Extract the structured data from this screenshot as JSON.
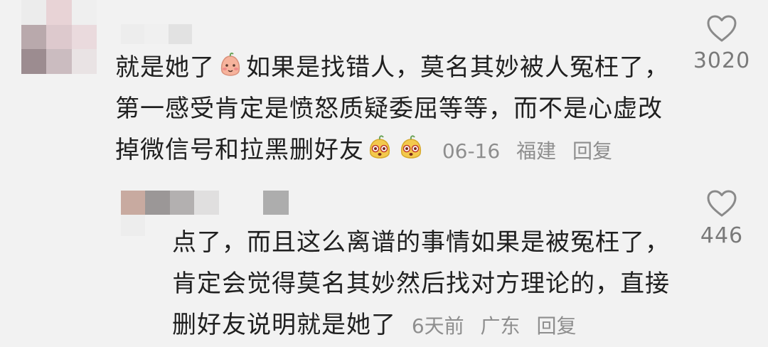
{
  "comments": [
    {
      "text_lines": [
        "就是她了",
        "如果是找错人，莫名其妙被人冤枉了，",
        "第一感受肯定是愤怒质疑委屈等等，而不是心虚改",
        "掉微信号和拉黑删好友"
      ],
      "emoji_names": [
        "blush-face-emoji",
        "shocked-face-emoji",
        "shocked-face-emoji"
      ],
      "date": "06-16",
      "location": "福建",
      "reply_label": "回复",
      "likes": "3020"
    },
    {
      "text_lines": [
        "点了，而且这么离谱的事情如果是被冤枉了，",
        "肯定会觉得莫名其妙然后找对方理论的，直接",
        "删好友说明就是她了"
      ],
      "date": "6天前",
      "location": "广东",
      "reply_label": "回复",
      "likes": "446"
    }
  ],
  "colors": {
    "background": "#f2f2f2",
    "text": "#202020",
    "meta": "#8e8e8e",
    "heart_stroke": "#8a8a8a"
  }
}
